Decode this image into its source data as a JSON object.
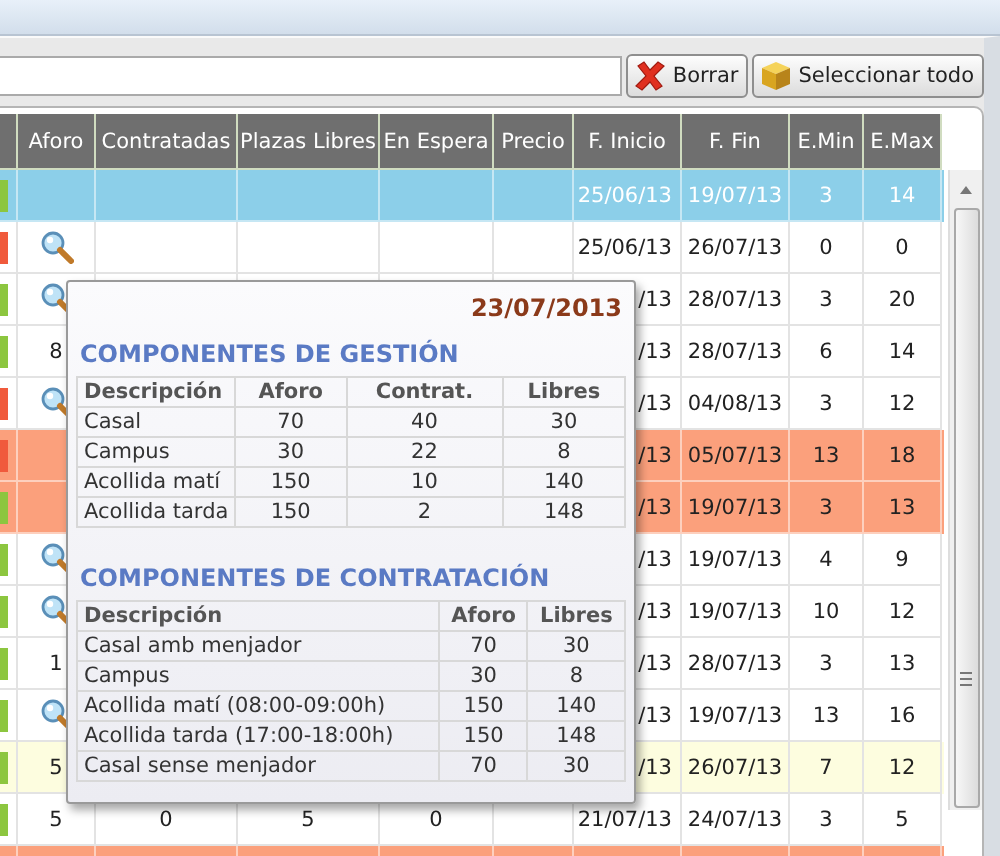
{
  "toolbar": {
    "buttons": [
      {
        "label": "Borrar",
        "kind": "delete"
      },
      {
        "label": "Seleccionar todo",
        "kind": "select"
      }
    ]
  },
  "table": {
    "columns": [
      "Aforo",
      "Contratadas",
      "Plazas Libres",
      "En Espera",
      "Precio",
      "F. Inicio",
      "F. Fin",
      "E.Min",
      "E.Max"
    ],
    "rows": [
      {
        "selected": true,
        "kind": "normal",
        "color": "#8cc63f",
        "search_icon": false,
        "cells": [
          null,
          null,
          null,
          null,
          null,
          "25/06/13",
          "19/07/13",
          "3",
          "14"
        ]
      },
      {
        "selected": false,
        "kind": "normal",
        "color": "#f05a3c",
        "search_icon": true,
        "cells": [
          null,
          null,
          null,
          null,
          null,
          "25/06/13",
          "26/07/13",
          "0",
          "0"
        ]
      },
      {
        "selected": false,
        "kind": "normal",
        "color": "#8cc63f",
        "search_icon": true,
        "cells": [
          null,
          null,
          null,
          null,
          null,
          "/13",
          "28/07/13",
          "3",
          "20"
        ]
      },
      {
        "selected": false,
        "kind": "normal",
        "color": "#8cc63f",
        "search_icon": false,
        "cells": [
          "8",
          null,
          null,
          null,
          null,
          "/13",
          "28/07/13",
          "6",
          "14"
        ]
      },
      {
        "selected": false,
        "kind": "normal",
        "color": "#f05a3c",
        "search_icon": true,
        "cells": [
          null,
          null,
          null,
          null,
          null,
          "/13",
          "04/08/13",
          "3",
          "12"
        ]
      },
      {
        "selected": false,
        "kind": "warning",
        "color": "#f05a3c",
        "search_icon": false,
        "cells": [
          null,
          null,
          null,
          null,
          null,
          "/13",
          "05/07/13",
          "13",
          "18"
        ]
      },
      {
        "selected": false,
        "kind": "warning",
        "color": "#8cc63f",
        "search_icon": false,
        "cells": [
          null,
          null,
          null,
          null,
          null,
          "/13",
          "19/07/13",
          "3",
          "13"
        ]
      },
      {
        "selected": false,
        "kind": "normal",
        "color": "#8cc63f",
        "search_icon": true,
        "cells": [
          null,
          null,
          null,
          null,
          null,
          "/13",
          "19/07/13",
          "4",
          "9"
        ]
      },
      {
        "selected": false,
        "kind": "normal",
        "color": "#8cc63f",
        "search_icon": true,
        "cells": [
          null,
          null,
          null,
          null,
          null,
          "/13",
          "19/07/13",
          "10",
          "12"
        ]
      },
      {
        "selected": false,
        "kind": "normal",
        "color": "#8cc63f",
        "search_icon": false,
        "cells": [
          "1",
          null,
          null,
          null,
          null,
          "/13",
          "28/07/13",
          "3",
          "13"
        ]
      },
      {
        "selected": false,
        "kind": "normal",
        "color": "#8cc63f",
        "search_icon": true,
        "cells": [
          null,
          null,
          null,
          null,
          null,
          "/13",
          "19/07/13",
          "13",
          "16"
        ]
      },
      {
        "selected": false,
        "kind": "pending",
        "color": "#8cc63f",
        "search_icon": false,
        "cells": [
          "5",
          null,
          null,
          null,
          null,
          "/13",
          "26/07/13",
          "7",
          "12"
        ]
      },
      {
        "selected": false,
        "kind": "normal",
        "color": "#8cc63f",
        "search_icon": false,
        "cells": [
          "5",
          "0",
          "5",
          "0",
          null,
          "21/07/13",
          "24/07/13",
          "3",
          "5"
        ]
      },
      {
        "selected": false,
        "kind": "warning",
        "search_icon": false
      }
    ]
  },
  "tooltip": {
    "date": "23/07/2013",
    "sections": [
      {
        "title": "COMPONENTES DE GESTIÓN",
        "columns": [
          "Descripción",
          "Aforo",
          "Contrat.",
          "Libres"
        ],
        "rows": [
          [
            "Casal",
            "70",
            "40",
            "30"
          ],
          [
            "Campus",
            "30",
            "22",
            "8"
          ],
          [
            "Acollida matí",
            "150",
            "10",
            "140"
          ],
          [
            "Acollida tarda",
            "150",
            "2",
            "148"
          ]
        ]
      },
      {
        "title": "COMPONENTES DE CONTRATACIÓN",
        "columns": [
          "Descripción",
          "Aforo",
          "Libres"
        ],
        "rows": [
          [
            "Casal amb menjador",
            "70",
            "30"
          ],
          [
            "Campus",
            "30",
            "8"
          ],
          [
            "Acollida matí (08:00-09:00h)",
            "150",
            "140"
          ],
          [
            "Acollida tarda (17:00-18:00h)",
            "150",
            "148"
          ],
          [
            "Casal sense menjador",
            "70",
            "30"
          ]
        ]
      }
    ]
  }
}
